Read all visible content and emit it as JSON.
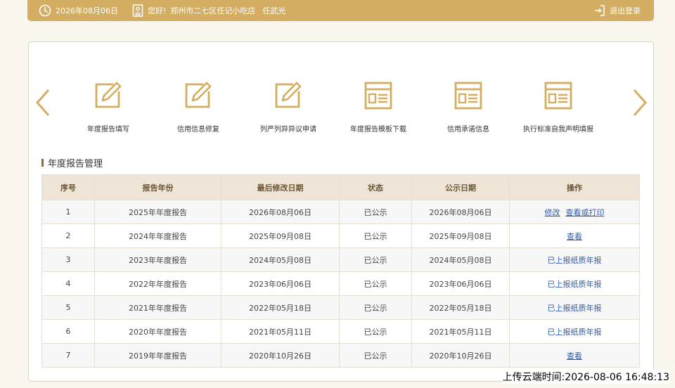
{
  "topbar": {
    "date": "2026年08月06日",
    "greeting": "您好!",
    "company": "郑州市二七区任记小吃店",
    "person": "任武光",
    "logout": "退出登录"
  },
  "functions": [
    {
      "label": "年度报告填写",
      "icon": "edit-icon"
    },
    {
      "label": "信用信息修复",
      "icon": "edit-icon"
    },
    {
      "label": "列严列异异议申请",
      "icon": "edit-icon"
    },
    {
      "label": "年度报告模板下载",
      "icon": "document-icon"
    },
    {
      "label": "信用承诺信息",
      "icon": "document-icon"
    },
    {
      "label": "执行标准自我声明填报",
      "icon": "document-icon"
    }
  ],
  "section": {
    "title": "年度报告管理"
  },
  "table": {
    "headers": [
      "序号",
      "报告年份",
      "最后修改日期",
      "状态",
      "公示日期",
      "操作"
    ],
    "rows": [
      {
        "no": "1",
        "year": "2025年年度报告",
        "modified": "2026年08月06日",
        "status": "已公示",
        "published": "2026年08月06日",
        "actions": [
          "修改",
          "查看或打印"
        ],
        "underline": true
      },
      {
        "no": "2",
        "year": "2024年年度报告",
        "modified": "2025年09月08日",
        "status": "已公示",
        "published": "2025年09月08日",
        "actions": [
          "查看"
        ],
        "underline": true
      },
      {
        "no": "3",
        "year": "2023年年度报告",
        "modified": "2024年05月08日",
        "status": "已公示",
        "published": "2024年05月08日",
        "actions": [
          "已上报纸质年报"
        ],
        "underline": false
      },
      {
        "no": "4",
        "year": "2022年年度报告",
        "modified": "2023年06月06日",
        "status": "已公示",
        "published": "2023年06月06日",
        "actions": [
          "已上报纸质年报"
        ],
        "underline": false
      },
      {
        "no": "5",
        "year": "2021年年度报告",
        "modified": "2022年05月18日",
        "status": "已公示",
        "published": "2022年05月18日",
        "actions": [
          "已上报纸质年报"
        ],
        "underline": false
      },
      {
        "no": "6",
        "year": "2020年年度报告",
        "modified": "2021年05月11日",
        "status": "已公示",
        "published": "2021年05月11日",
        "actions": [
          "已上报纸质年报"
        ],
        "underline": false
      },
      {
        "no": "7",
        "year": "2019年年度报告",
        "modified": "2020年10月26日",
        "status": "已公示",
        "published": "2020年10月26日",
        "actions": [
          "查看"
        ],
        "underline": true
      }
    ]
  },
  "upload_time": "上传云端时间:2026-08-06 16:48:13",
  "colors": {
    "brand": "#d2ad62",
    "link": "#2f5bb0",
    "header_bg": "#efe5d6"
  }
}
